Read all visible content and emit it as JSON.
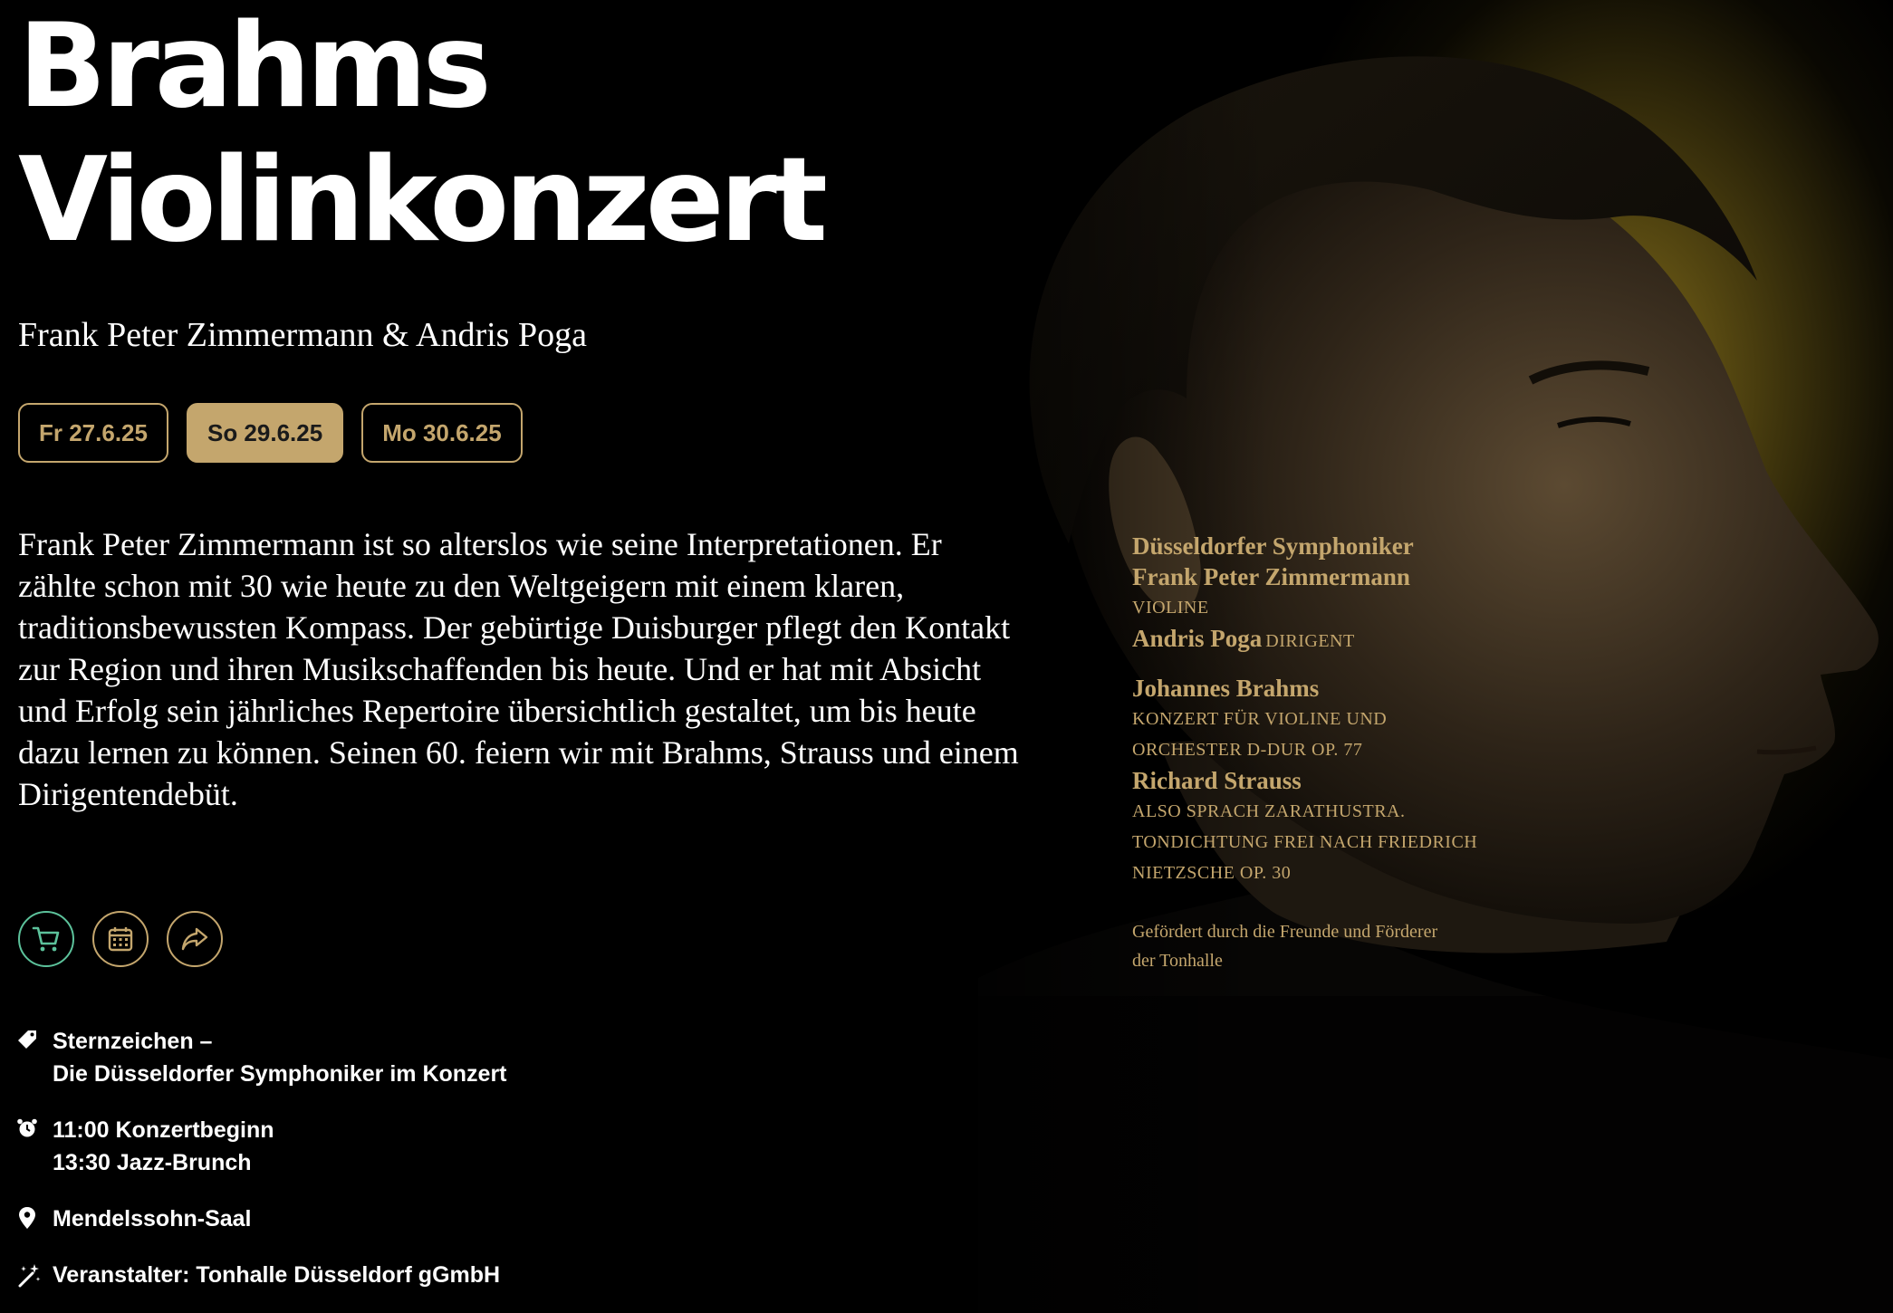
{
  "title": {
    "line1": "Brahms",
    "line2": "Violinkonzert"
  },
  "subtitle": "Frank Peter Zimmermann & Andris Poga",
  "dates": [
    {
      "label": "Fr 27.6.25",
      "active": false
    },
    {
      "label": "So 29.6.25",
      "active": true
    },
    {
      "label": "Mo 30.6.25",
      "active": false
    }
  ],
  "description": "Frank Peter Zimmermann ist so alterslos wie seine Interpretationen. Er zählte schon mit 30 wie heute zu den Weltgeigern mit einem klaren, traditionsbewussten Kompass. Der gebürtige Duisburger pflegt den Kontakt zur Region und ihren Musikschaffenden bis heute. Und er hat mit Absicht und Erfolg sein jährliches Repertoire übersichtlich gestaltet, um bis heute dazu lernen zu können. Seinen 60. feiern wir mit Brahms, Strauss und einem Dirigentendebüt.",
  "actions": {
    "cart": "cart-icon",
    "calendar": "calendar-icon",
    "share": "share-icon"
  },
  "info": {
    "series_line1": "Sternzeichen –",
    "series_line2": "Die Düsseldorfer Symphoniker im Konzert",
    "time_line1": "11:00 Konzertbeginn",
    "time_line2": "13:30 Jazz-Brunch",
    "venue": "Mendelssohn-Saal",
    "organizer": "Veranstalter: Tonhalle Düsseldorf gGmbH"
  },
  "credits": {
    "orchestra": "Düsseldorfer Symphoniker",
    "soloist": "Frank Peter Zimmermann",
    "soloist_role": "VIOLINE",
    "conductor": "Andris Poga",
    "conductor_role": "DIRIGENT",
    "composer1": "Johannes Brahms",
    "work1_line1": "KONZERT FÜR VIOLINE UND",
    "work1_line2": "ORCHESTER D-DUR OP. 77",
    "composer2": "Richard Strauss",
    "work2_line1": "ALSO SPRACH ZARATHUSTRA.",
    "work2_line2": "TONDICHTUNG FREI NACH FRIEDRICH",
    "work2_line3": "NIETZSCHE OP. 30",
    "support_line1": "Gefördert durch die Freunde und Förderer",
    "support_line2": "der Tonhalle"
  },
  "colors": {
    "gold": "#c4a66d",
    "accent_green": "#5cc29b",
    "background": "#000000"
  }
}
